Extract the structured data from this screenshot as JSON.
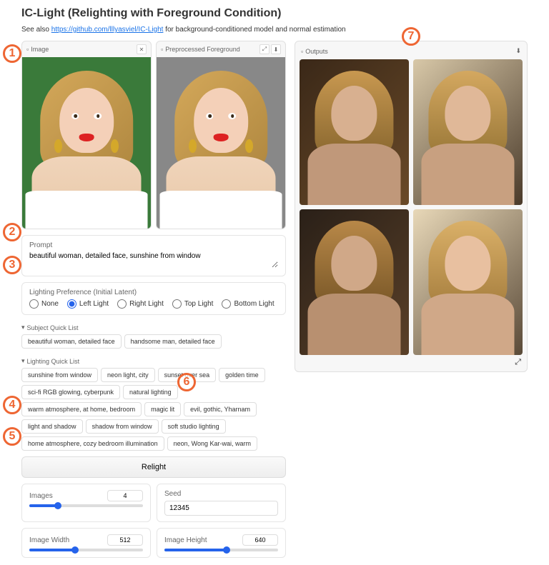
{
  "title": "IC-Light (Relighting with Foreground Condition)",
  "subtitle_prefix": "See also ",
  "subtitle_link": "https://github.com/lllyasviel/IC-Light",
  "subtitle_suffix": " for background-conditioned model and normal estimation",
  "image_panel": {
    "label": "Image"
  },
  "preprocessed_panel": {
    "label": "Preprocessed Foreground"
  },
  "prompt": {
    "label": "Prompt",
    "value": "beautiful woman, detailed face, sunshine from window"
  },
  "lighting": {
    "label": "Lighting Preference (Initial Latent)",
    "options": [
      "None",
      "Left Light",
      "Right Light",
      "Top Light",
      "Bottom Light"
    ],
    "selected": "Left Light"
  },
  "subject_quick": {
    "label": "Subject Quick List",
    "items": [
      "beautiful woman, detailed face",
      "handsome man, detailed face"
    ]
  },
  "lighting_quick": {
    "label": "Lighting Quick List",
    "items": [
      "sunshine from window",
      "neon light, city",
      "sunset over sea",
      "golden time",
      "sci-fi RGB glowing, cyberpunk",
      "natural lighting",
      "warm atmosphere, at home, bedroom",
      "magic lit",
      "evil, gothic, Yharnam",
      "light and shadow",
      "shadow from window",
      "soft studio lighting",
      "home atmosphere, cozy bedroom illumination",
      "neon, Wong Kar-wai, warm"
    ]
  },
  "relight_label": "Relight",
  "controls": {
    "images": {
      "label": "Images",
      "value": "4",
      "fill_pct": 25
    },
    "seed": {
      "label": "Seed",
      "value": "12345"
    },
    "width": {
      "label": "Image Width",
      "value": "512",
      "fill_pct": 40
    },
    "height": {
      "label": "Image Height",
      "value": "640",
      "fill_pct": 55
    }
  },
  "outputs": {
    "label": "Outputs"
  },
  "annotations": [
    "1",
    "2",
    "3",
    "4",
    "5",
    "6",
    "7"
  ]
}
